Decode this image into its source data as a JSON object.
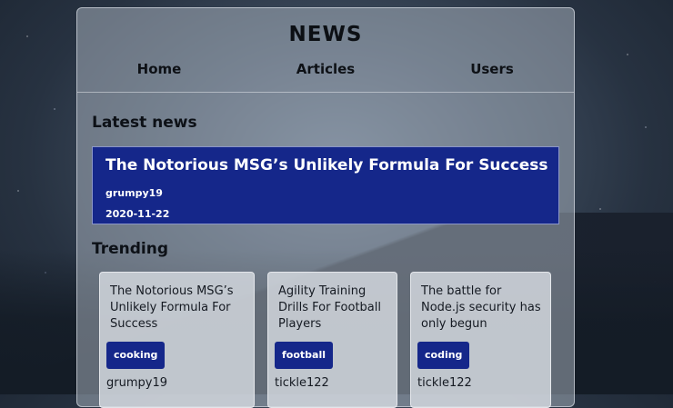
{
  "header": {
    "site_title": "NEWS",
    "nav": [
      "Home",
      "Articles",
      "Users"
    ]
  },
  "latest": {
    "heading": "Latest news",
    "article": {
      "title": "The Notorious MSG’s Unlikely Formula For Success",
      "author": "grumpy19",
      "date": "2020-11-22"
    }
  },
  "trending": {
    "heading": "Trending",
    "cards": [
      {
        "title": "The Notorious MSG’s Unlikely Formula For Success",
        "tag": "cooking",
        "author": "grumpy19"
      },
      {
        "title": "Agility Training Drills For Football Players",
        "tag": "football",
        "author": "tickle122"
      },
      {
        "title": "The battle for Node.js security has only begun",
        "tag": "coding",
        "author": "tickle122"
      }
    ]
  },
  "colors": {
    "accent": "#15278a"
  }
}
